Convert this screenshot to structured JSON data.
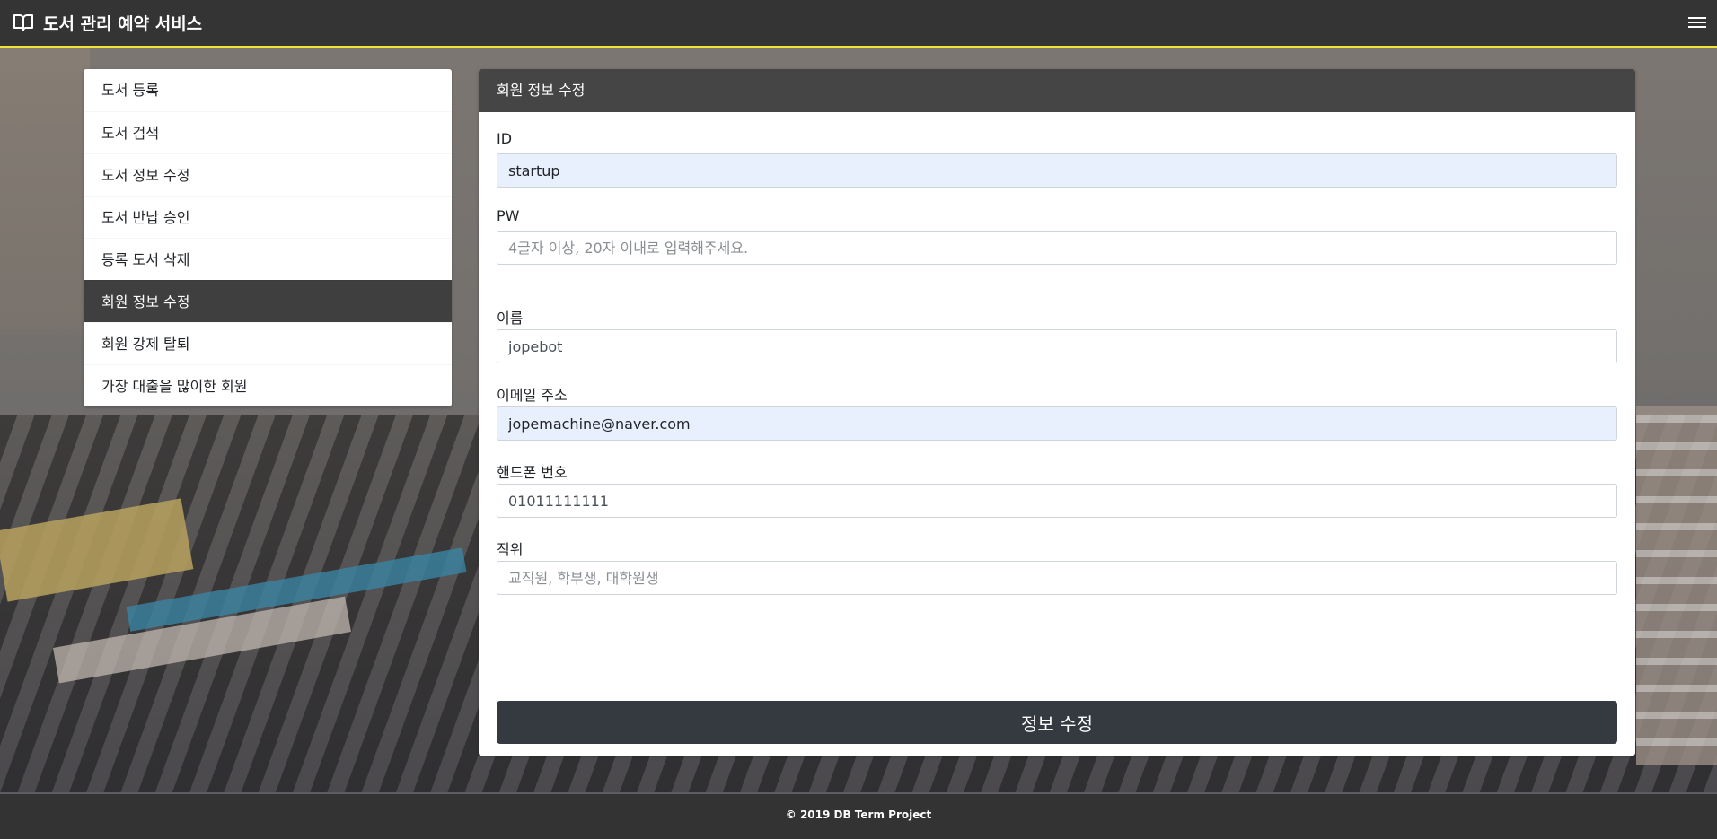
{
  "navbar": {
    "title": "도서 관리 예약 서비스",
    "brand_icon": "book-open-icon",
    "menu_icon": "hamburger-icon",
    "accent_color": "#f2e336"
  },
  "sidebar": {
    "items": [
      {
        "label": "도서 등록"
      },
      {
        "label": "도서 검색"
      },
      {
        "label": "도서 정보 수정"
      },
      {
        "label": "도서 반납 승인"
      },
      {
        "label": "등록 도서 삭제"
      },
      {
        "label": "회원 정보 수정",
        "active": true
      },
      {
        "label": "회원 강제 탈퇴"
      },
      {
        "label": "가장 대출을 많이한 회원"
      }
    ]
  },
  "card": {
    "title": "회원 정보 수정",
    "fields": {
      "id": {
        "label": "ID",
        "value": "startup"
      },
      "pw": {
        "label": "PW",
        "value": "",
        "placeholder": "4글자 이상, 20자 이내로 입력해주세요."
      },
      "name": {
        "label": "이름",
        "value": "jopebot"
      },
      "email": {
        "label": "이메일 주소",
        "value": "jopemachine@naver.com"
      },
      "phone": {
        "label": "핸드폰 번호",
        "value": "01011111111"
      },
      "position": {
        "label": "직위",
        "value": "",
        "placeholder": "교직원, 학부생, 대학원생"
      }
    },
    "submit_label": "정보 수정"
  },
  "footer": {
    "text": "© 2019 DB Term Project"
  }
}
